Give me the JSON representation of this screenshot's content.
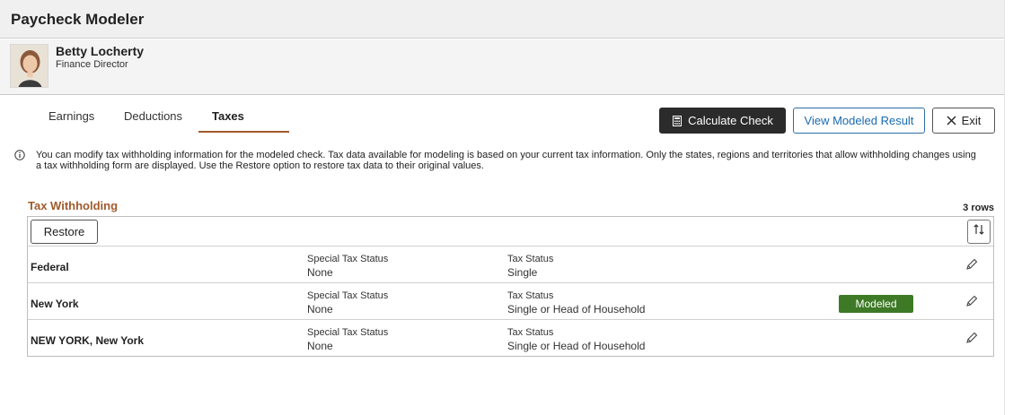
{
  "app": {
    "title": "Paycheck Modeler"
  },
  "profile": {
    "name": "Betty Locherty",
    "role": "Finance Director"
  },
  "tabs": [
    {
      "label": "Earnings",
      "active": false
    },
    {
      "label": "Deductions",
      "active": false
    },
    {
      "label": "Taxes",
      "active": true
    }
  ],
  "actions": {
    "calculate_label": "Calculate Check",
    "calculate_icon": "calculator-icon",
    "view_result_label": "View Modeled Result",
    "exit_label": "Exit",
    "exit_icon": "close-icon"
  },
  "info": {
    "icon": "info-icon",
    "text": "You can modify tax withholding information for the modeled check. Tax data available for modeling is based on your current tax information. Only the states, regions and territories that allow withholding changes using a tax withholding form are displayed. Use the Restore option to restore tax data to their original values."
  },
  "tax_withholding": {
    "title": "Tax Withholding",
    "row_count": "3 rows",
    "restore_label": "Restore",
    "sort_icon": "sort-icon",
    "rows": [
      {
        "name": "Federal",
        "special_label": "Special Tax Status",
        "special_value": "None",
        "status_label": "Tax Status",
        "status_value": "Single",
        "badge": "",
        "edit_icon": "pencil-icon"
      },
      {
        "name": "New York",
        "special_label": "Special Tax Status",
        "special_value": "None",
        "status_label": "Tax Status",
        "status_value": "Single or Head of Household",
        "badge": "Modeled",
        "edit_icon": "pencil-icon"
      },
      {
        "name": "NEW YORK, New York",
        "special_label": "Special Tax Status",
        "special_value": "None",
        "status_label": "Tax Status",
        "status_value": "Single or Head of Household",
        "badge": "",
        "edit_icon": "pencil-icon"
      }
    ]
  },
  "colors": {
    "accent": "#a05a2c",
    "badge_green": "#3e7a26",
    "link_blue": "#1a6ab0",
    "dark_button": "#2b2b2b"
  }
}
